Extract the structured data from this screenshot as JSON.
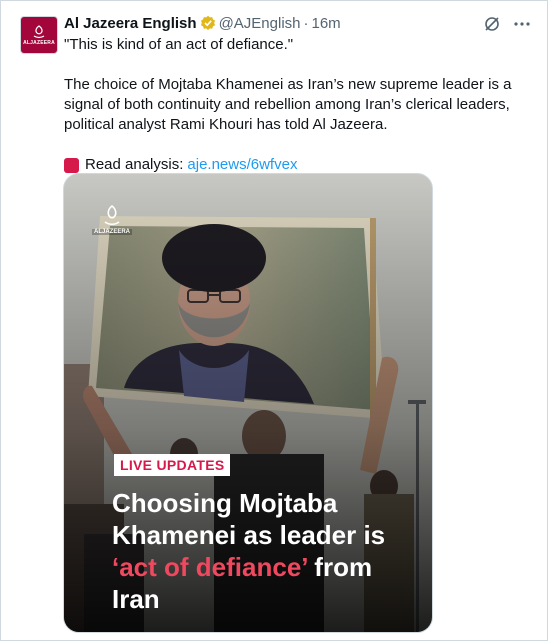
{
  "account": {
    "display_name": "Al Jazeera English",
    "handle": "@AJEnglish",
    "separator": "·",
    "time": "16m",
    "avatar_text": "ALJAZEERA"
  },
  "tweet": {
    "quote": "\"This is kind of an act of defiance.\"",
    "body": "The choice of Mojtaba Khamenei as Iran’s new supreme leader is a signal of both continuity and rebellion among Iran’s clerical leaders, political analyst Rami Khouri has told Al Jazeera.",
    "read_label": "Read analysis:",
    "link_text": "aje.news/6wfvex"
  },
  "media": {
    "watermark_text": "ALJAZEERA",
    "badge": "LIVE UPDATES",
    "headline_part1": "Choosing Mojtaba Khamenei as leader is ",
    "headline_accent": "‘act of defiance’",
    "headline_part2": " from Iran"
  },
  "icons": {
    "verified": "verified-badge-icon",
    "grok": "grok-icon",
    "more": "more-icon",
    "read": "red-square-icon"
  },
  "colors": {
    "brand": "#a3063a",
    "link": "#1d9bf0",
    "accent": "#d6194b",
    "verified": "#e2b719"
  }
}
